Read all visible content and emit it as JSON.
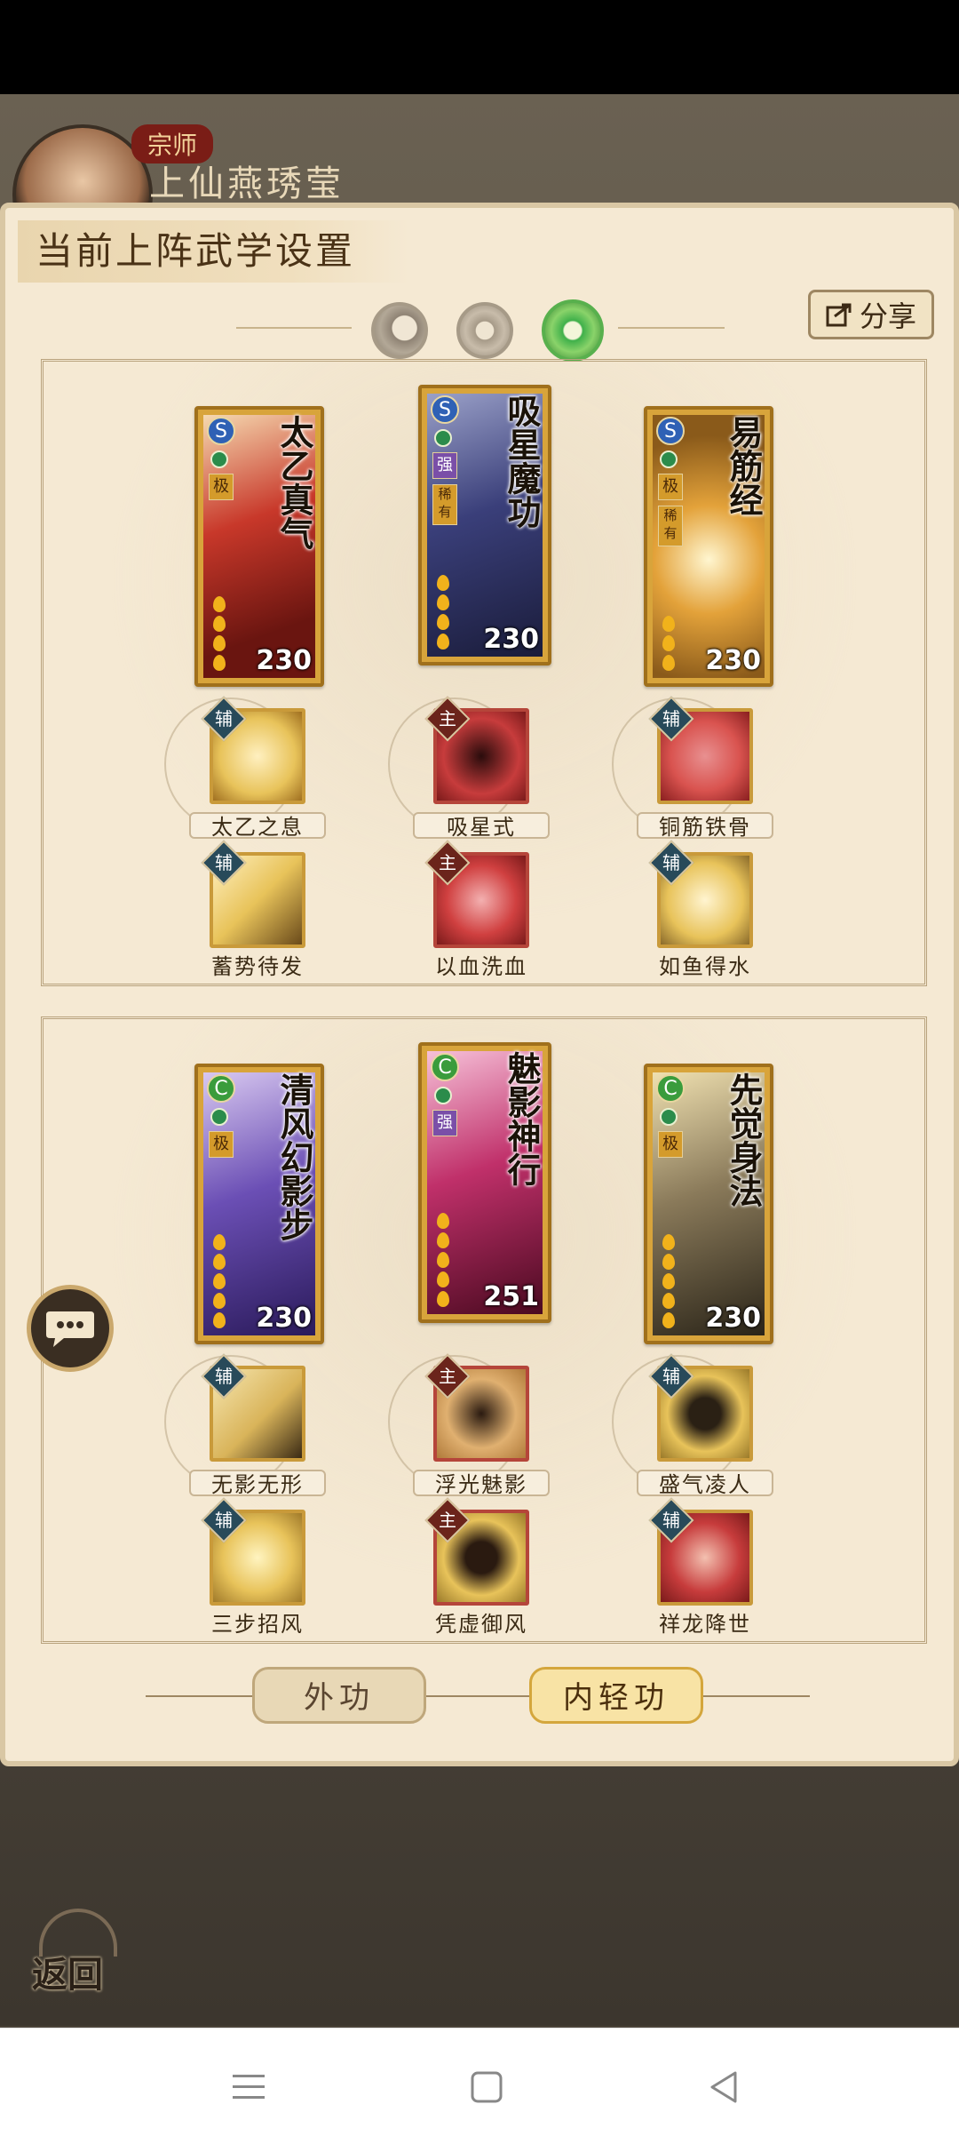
{
  "player": {
    "rank": "宗师",
    "name": "上仙燕琇莹"
  },
  "panel": {
    "title": "当前上阵武学设置",
    "share_label": "分享"
  },
  "mode_tabs": [
    {
      "icon": "moon-orb-icon",
      "selected": false
    },
    {
      "icon": "sun-orb-icon",
      "selected": false
    },
    {
      "icon": "jade-orb-icon",
      "selected": true
    }
  ],
  "sections": [
    {
      "cards": [
        {
          "title": "太乙真气",
          "school": "S",
          "grade": "极",
          "power": "230",
          "accent": "#c8382a"
        },
        {
          "title": "吸星魔功",
          "school": "S",
          "grade": "强",
          "rarity": "稀有",
          "power": "230",
          "accent": "#3a3f7a"
        },
        {
          "title": "易筋经",
          "school": "S",
          "grade": "极",
          "rarity": "稀有",
          "power": "230",
          "accent": "#e3a23a"
        }
      ],
      "skills_row1": [
        {
          "type": "辅",
          "label": "太乙之息",
          "accent": "#e8c35a"
        },
        {
          "type": "主",
          "label": "吸星式",
          "accent": "#c73c3c"
        },
        {
          "type": "辅",
          "label": "铜筋铁骨",
          "accent": "#d9534f"
        }
      ],
      "skills_row2": [
        {
          "type": "辅",
          "label": "蓄势待发",
          "accent": "#e8c35a"
        },
        {
          "type": "主",
          "label": "以血洗血",
          "accent": "#d04040"
        },
        {
          "type": "辅",
          "label": "如鱼得水",
          "accent": "#e8c35a"
        }
      ]
    },
    {
      "cards": [
        {
          "title": "清风幻影步",
          "school": "C",
          "grade": "极",
          "power": "230",
          "accent": "#6b4fb5"
        },
        {
          "title": "魅影神行",
          "school": "C",
          "grade": "强",
          "power": "251",
          "accent": "#c0306a"
        },
        {
          "title": "先觉身法",
          "school": "C",
          "grade": "极",
          "power": "230",
          "accent": "#8a7a5a"
        }
      ],
      "skills_row1": [
        {
          "type": "辅",
          "label": "无影无形",
          "accent": "#d9b45a"
        },
        {
          "type": "主",
          "label": "浮光魅影",
          "accent": "#e0b070"
        },
        {
          "type": "辅",
          "label": "盛气凌人",
          "accent": "#e8c35a"
        }
      ],
      "skills_row2": [
        {
          "type": "辅",
          "label": "三步招风",
          "accent": "#e8c35a"
        },
        {
          "type": "主",
          "label": "凭虚御风",
          "accent": "#e8c35a"
        },
        {
          "type": "辅",
          "label": "祥龙降世",
          "accent": "#c73c3c"
        }
      ]
    }
  ],
  "bottom_tabs": [
    {
      "label": "外功",
      "selected": false
    },
    {
      "label": "内轻功",
      "selected": true
    }
  ],
  "back_label": "返回"
}
